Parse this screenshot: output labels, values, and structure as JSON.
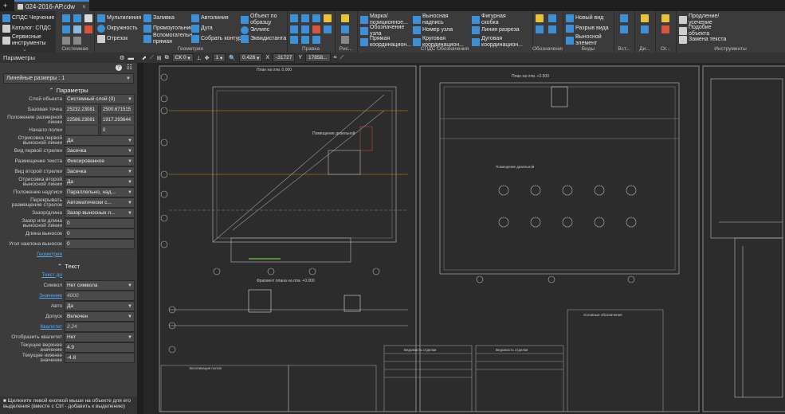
{
  "titlebar": {
    "doc_name": "024-2016-АР.cdw"
  },
  "ribbon": {
    "mode": [
      "СПДС Черчение",
      "Каталог: СПДС",
      "Сервисные инструменты"
    ],
    "groups": [
      {
        "title": "Системная"
      },
      {
        "title": "Геометрия"
      },
      {
        "title": "Правка"
      },
      {
        "title": "Рис..."
      },
      {
        "title": "СПДС Обозначения"
      },
      {
        "title": "Обозначения"
      },
      {
        "title": "Виды"
      },
      {
        "title": "Вст..."
      },
      {
        "title": "Ди..."
      },
      {
        "title": "Ог..."
      },
      {
        "title": "Инструменты"
      }
    ],
    "geometry": [
      "Мультилиния",
      "Окружность",
      "Отрезок",
      "Заливка",
      "Прямоугольник",
      "Вспомогательн... прямая",
      "Автолиния",
      "Дуга",
      "Собрать контур",
      "Объект по образцу",
      "Эллипс",
      "Эквидистанта"
    ],
    "marks": [
      "Марка/позиционное...",
      "Обозначение узла",
      "Прямая координацион...",
      "Выносная надпись",
      "Номер узла",
      "Круговая координацион...",
      "Фигурная скобка",
      "Линия разреза",
      "Дуговая координацион..."
    ],
    "views": [
      "Новый вид",
      "Разрыв вида",
      "Выносной элемент"
    ],
    "tools": [
      "Продление/ усечение",
      "Подобие объекта",
      "Замена текста"
    ]
  },
  "panel": {
    "title": "Параметры",
    "style_dropdown": "Линейные размеры : 1",
    "section_params": "Параметры",
    "props": [
      {
        "label": "Слой объекта",
        "value": "Системный слой (0)",
        "type": "dropdown"
      },
      {
        "label": "Базовая точка",
        "values": [
          "25232.23081",
          "2500.671515"
        ],
        "type": "split"
      },
      {
        "label": "Положение размерной линии",
        "values": [
          "22586.23081",
          "1917.293644"
        ],
        "type": "split"
      },
      {
        "label": "Начало полки",
        "value": "0",
        "type": "split-empty"
      },
      {
        "label": "Отрисовка первой выносной линии",
        "value": "Да",
        "type": "dropdown"
      },
      {
        "label": "Вид первой стрелки",
        "value": "Засечка",
        "type": "dropdown"
      },
      {
        "label": "Размещение текста",
        "value": "Фиксированное",
        "type": "dropdown"
      },
      {
        "label": "Вид второй стрелки",
        "value": "Засечка",
        "type": "dropdown"
      },
      {
        "label": "Отрисовка второй выносной линии",
        "value": "Да",
        "type": "dropdown"
      },
      {
        "label": "Положение надписи",
        "value": "Параллельно, над...",
        "type": "dropdown"
      },
      {
        "label": "Перекрывать размещение стрелок",
        "value": "Автоматически с...",
        "type": "dropdown"
      },
      {
        "label": "Зазор/длина",
        "value": "Зазор выносных л...",
        "type": "dropdown"
      },
      {
        "label": "Зазор или длина выносной линии",
        "value": "0",
        "type": "text"
      },
      {
        "label": "Длина выносок",
        "value": "0",
        "type": "text"
      },
      {
        "label": "Угол наклона выносок",
        "value": "0",
        "type": "text"
      },
      {
        "label": "Геометрия",
        "value": "",
        "type": "link"
      }
    ],
    "section_text": "Текст",
    "text_props": [
      {
        "label": "Текст до",
        "value": "",
        "type": "link"
      },
      {
        "label": "Символ",
        "value": "Нет символа",
        "type": "dropdown"
      },
      {
        "label": "Значение",
        "value": "4000",
        "type": "link-italic"
      },
      {
        "label": "Авто",
        "value": "Да",
        "type": "dropdown"
      },
      {
        "label": "Допуск",
        "value": "Включен",
        "type": "dropdown"
      },
      {
        "label": "Квалитет",
        "value": "2.24",
        "type": "link-italic"
      },
      {
        "label": "Отобразить квалитет",
        "value": "Нет",
        "type": "dropdown"
      },
      {
        "label": "Текущее верхнее значение",
        "value": "4.9",
        "type": "text"
      },
      {
        "label": "Текущее нижнее значение",
        "value": "-4.8",
        "type": "text"
      }
    ],
    "hint": "Щелкните левой кнопкой мыши на объекте для его выделения (вместе с Ctrl - добавить к выделению)"
  },
  "canvas_toolbar": {
    "layer": "СК 0",
    "layer_num": "1",
    "zoom": "0.426",
    "x": "-31727",
    "y": "17858..."
  },
  "sheets": {
    "plan1_title": "План на отм. 0.000",
    "plan1_sub": "Фрагмент плана на отм. +0.000",
    "plan2_title": "План на отм. +2.500",
    "note_header": "Условные обозначения",
    "table1_title": "Ведомость отделки",
    "table2_title": "Ведомость отделки",
    "table3_title": "Экспликация полов",
    "room1": "Помещение дизельной",
    "room2": "Помещение дизельной",
    "room3": "Помещение дизельной"
  },
  "colors": {
    "accent": "#3c87d6",
    "panel_bg": "#3c3c3c",
    "canvas_bg": "#262626",
    "link": "#5aa9f0"
  }
}
